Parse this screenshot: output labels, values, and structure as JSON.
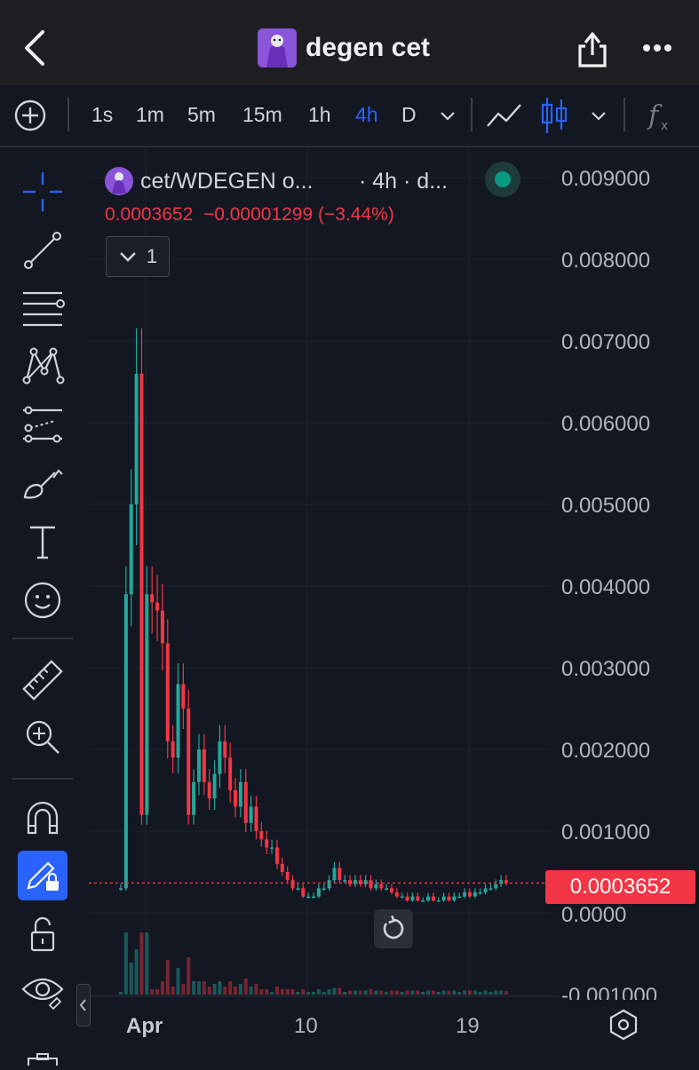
{
  "header": {
    "title": "degen cet"
  },
  "toolbar": {
    "timeframes": [
      "1s",
      "1m",
      "5m",
      "15m",
      "1h",
      "4h",
      "D"
    ],
    "active_timeframe": "4h"
  },
  "legend": {
    "symbol": "cet/WDEGEN o...",
    "interval_exchange": "· 4h · d...",
    "last": "0.0003652",
    "change": "−0.00001299",
    "change_pct": "(−3.44%)",
    "collapse_count": "1",
    "status_color": "#089981"
  },
  "colors": {
    "up": "#26a69a",
    "down": "#f23645",
    "accent": "#2962ff"
  },
  "chart_data": {
    "type": "candlestick",
    "price_axis_labels": [
      "0.009000",
      "0.008000",
      "0.007000",
      "0.006000",
      "0.005000",
      "0.004000",
      "0.003000",
      "0.002000",
      "0.001000",
      "0.0000",
      "-0.001000"
    ],
    "current_price": "0.0003652",
    "time_axis_labels": [
      "Apr",
      "10",
      "19"
    ],
    "ylim": [
      -0.001,
      0.009
    ],
    "close_series": [
      0.0003,
      0.0039,
      0.005,
      0.0066,
      0.0012,
      0.0039,
      0.0038,
      0.0037,
      0.0033,
      0.0021,
      0.0019,
      0.0028,
      0.0025,
      0.0012,
      0.0016,
      0.002,
      0.0016,
      0.0014,
      0.0017,
      0.0021,
      0.0019,
      0.0015,
      0.0013,
      0.0016,
      0.0011,
      0.0013,
      0.001,
      0.0009,
      0.0008,
      0.0008,
      0.0006,
      0.0005,
      0.0004,
      0.0003,
      0.0003,
      0.0002,
      0.0002,
      0.0002,
      0.0003,
      0.0003,
      0.0004,
      0.00055,
      0.0004,
      0.0004,
      0.00035,
      0.0004,
      0.00035,
      0.0004,
      0.0003,
      0.00035,
      0.0003,
      0.0003,
      0.00025,
      0.0002,
      0.0002,
      0.00015,
      0.0002,
      0.00015,
      0.00015,
      0.0002,
      0.00015,
      0.00015,
      0.0002,
      0.00015,
      0.0002,
      0.0002,
      0.00025,
      0.0002,
      0.00025,
      0.00025,
      0.0003,
      0.0003,
      0.00035,
      0.0004,
      0.00037
    ]
  }
}
